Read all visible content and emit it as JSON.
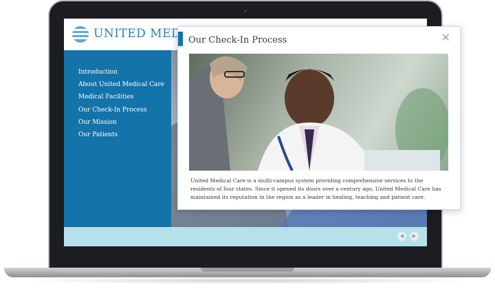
{
  "header": {
    "logo_text": "UNITED MEDICAL CARE"
  },
  "sidebar": {
    "items": [
      {
        "label": "Introduction"
      },
      {
        "label": "About United Medical Care"
      },
      {
        "label": "Medical Facilities"
      },
      {
        "label": "Our Check-In Process"
      },
      {
        "label": "Our Mission"
      },
      {
        "label": "Our Patients"
      }
    ]
  },
  "modal": {
    "title": "Our Check-In Process",
    "close_symbol": "✕",
    "body_text": "United Medical Care is a multi-campus system providing comprehensive services to the residents of four states.  Since it opened its doors over a century ago, United Medical Care has maintained its reputation in the region as a leader in healing, teaching and patient care."
  },
  "footer": {
    "prev_symbol": "◀",
    "next_symbol": "▶"
  },
  "icons": {
    "logo": "striped-circle-icon",
    "close": "close-icon",
    "prev": "arrow-left-icon",
    "next": "arrow-right-icon"
  },
  "colors": {
    "brand_blue": "#1473a8",
    "logo_blue": "#2a7fb8",
    "footer_bar": "#b6e0ea"
  }
}
